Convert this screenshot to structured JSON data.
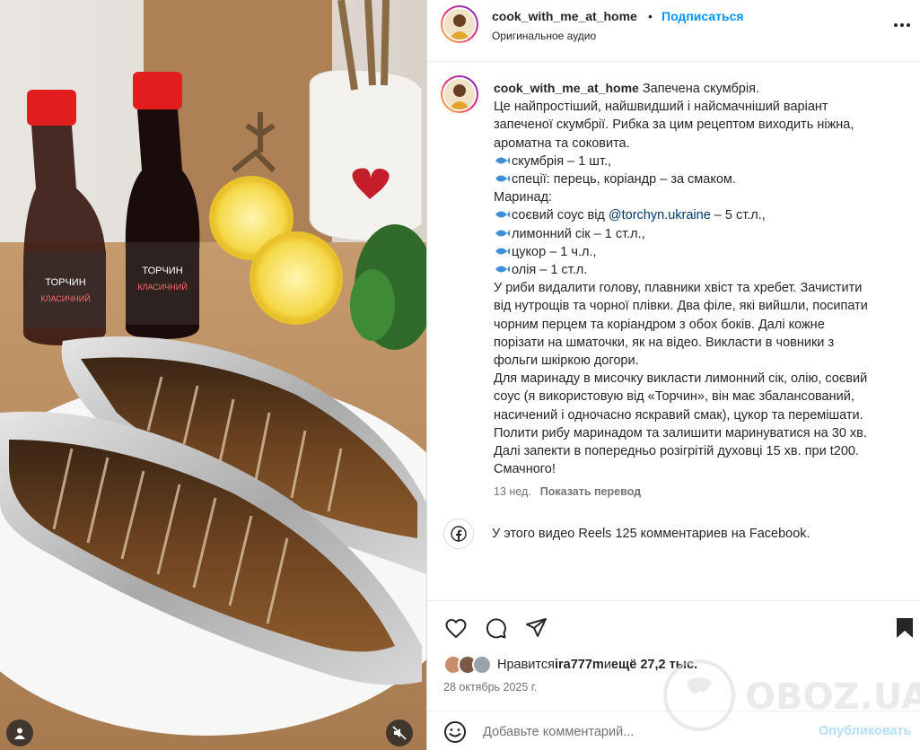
{
  "header": {
    "username": "cook_with_me_at_home",
    "separator": "•",
    "follow_label": "Подписаться",
    "audio_label": "Оригинальное аудио"
  },
  "caption": {
    "username": "cook_with_me_at_home",
    "lines": [
      "Запечена скумбрія.",
      "Це найпростіший, найшвидший і найсмачніший варіант",
      "запеченої скумбрії. Рибка за цим рецептом виходить ніжна,",
      "ароматна та соковита.",
      "скумбрія – 1 шт.,",
      "спеції: перець, коріандр – за смаком.",
      "Маринад:",
      "соєвий соус від ",
      "лимонний сік – 1 ст.л.,",
      "цукор – 1 ч.л.,",
      "олія – 1 ст.л.",
      "У риби видалити голову, плавники хвіст та хребет. Зачистити",
      "від нутрощів та чорної плівки. Два філе, які вийшли, посипати",
      "чорним перцем та коріандром з обох боків. Далі кожне",
      "порізати на шматочки, як на відео. Викласти в човники з",
      "фольги шкіркою догори.",
      "Для маринаду в мисочку викласти лимонний сік, олію, соєвий",
      "соус (я використовую від «Торчин», він має збалансований,",
      "насичений і одночасно яскравий смак), цукор та перемішати.",
      "Полити рибу маринадом та залишити маринуватися на 30 хв.",
      "Далі запекти в попередньо розігрітій духовці 15 хв. при t200.",
      "Смачного!"
    ],
    "mention": "@torchyn.ukraine",
    "mention_suffix": " – 5 ст.л.,",
    "time_ago": "13 нед.",
    "translate_label": "Показать перевод"
  },
  "facebook_note": "У этого видео Reels 125 комментариев на Facebook.",
  "likes": {
    "prefix": "Нравится ",
    "user": "ira777m",
    "middle": " и ",
    "others": "ещё 27,2 тыс."
  },
  "date": "28 октябрь 2025 г.",
  "comment": {
    "placeholder": "Добавьте комментарий...",
    "post_label": "Опубликовать"
  },
  "media": {
    "bottle_label": "ТОРЧИН",
    "bottle_sub": "КЛАСИЧНИЙ"
  },
  "watermark": "OBOZ.UA",
  "colors": {
    "accent": "#0095f6",
    "text": "#262626",
    "muted": "#737373",
    "post_disabled": "#b2dffc"
  },
  "icons": [
    "more-icon",
    "facebook-icon",
    "heart-icon",
    "comment-icon",
    "share-icon",
    "bookmark-icon",
    "emoji-icon",
    "user-tag-icon",
    "mute-icon",
    "fish-emoji-icon"
  ]
}
